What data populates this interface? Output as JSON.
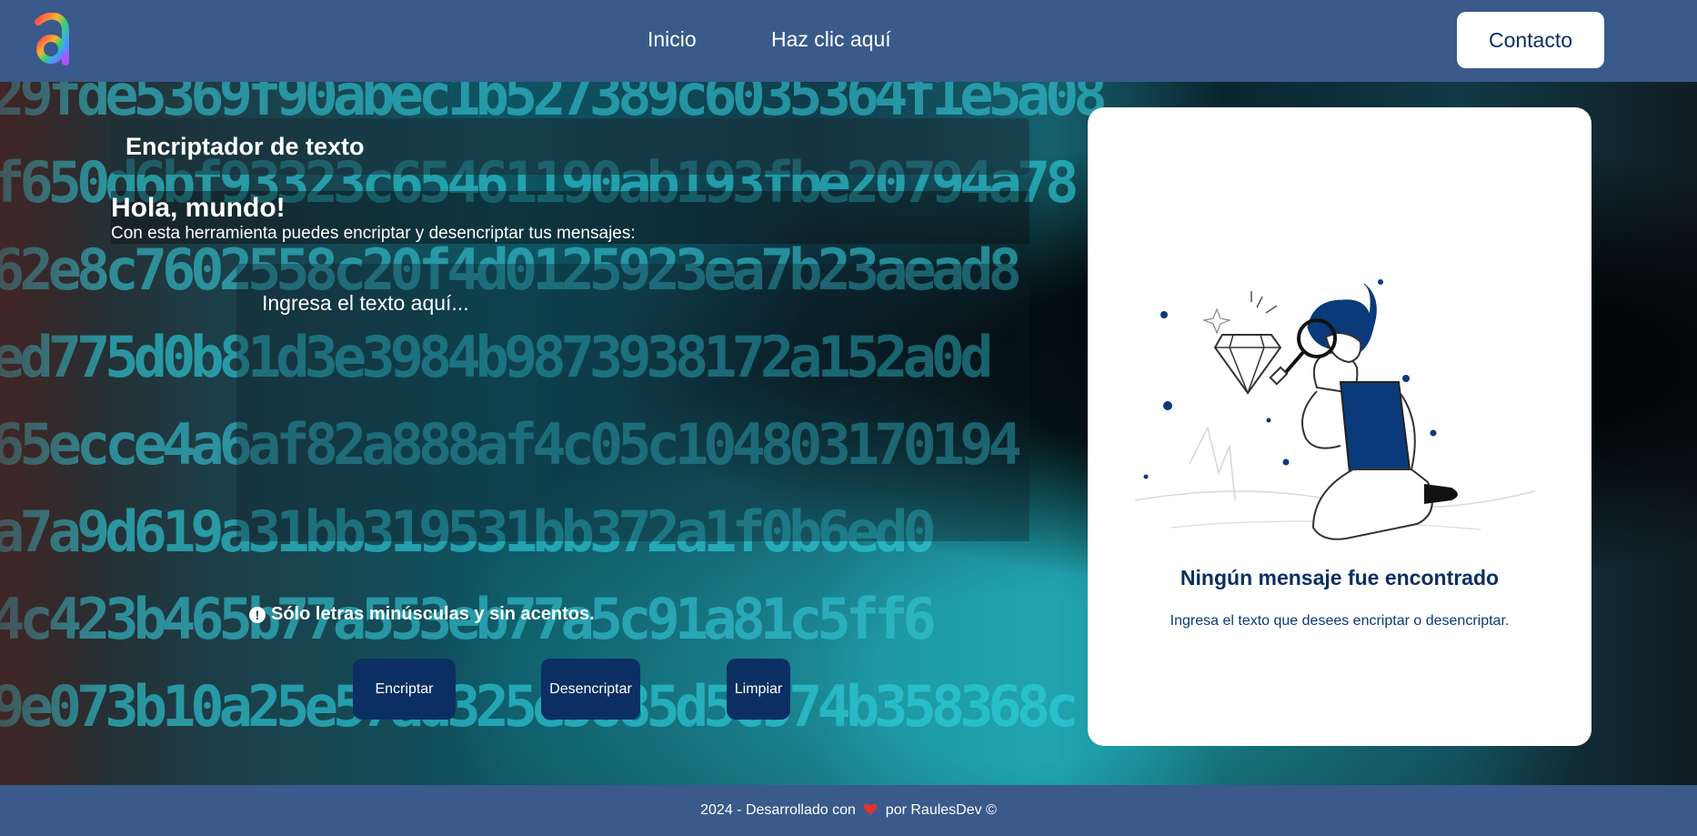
{
  "header": {
    "logo_icon": "letter-a-logo-icon",
    "nav": [
      {
        "label": "Inicio"
      },
      {
        "label": "Haz clic aquí"
      }
    ],
    "contact_label": "Contacto"
  },
  "background": {
    "code_lines": [
      "2 9 f d e 5 3 6 9 f 9 0 a b e c 1 b 5 2 7 3 8 9 c 6 0 3 5 3 6 4 f 1 e 5 a 0 8",
      "f 6 5 0 d 6 b f 9 3 3 2 3 c 6 5 4 6 1 1 9 0 a b 1 9 3 f b e 2 0 7 9 4 a 7 8",
      "6 2 e 8 c 7 6 0 2 5 5 8 c 2 0 f 4 d 0 1 2 5 9 2 3 e a 7 b 2 3 a e a d 8",
      "e d 7 7 5 d 0 b 8 1 d 3 e 3 9 8 4 b 9 8 7 3 9 3 8 1 7 2 a 1 5 2 a 0 d",
      "6 5 e c c e 4 a 6 a f 8 2 a 8 8 8 a f 4 c 0 5 c 1 0 4 8 0 3 1 7 0 1 9 4",
      "a 7 a 9 d 6 1 9 a 3 1 b b 3 1 9 5 3 1 b b 3 7 2 a 1 f 0 b 6 e d 0",
      "4 c 4 2 3 b 4 6 5 b 7 7 a 5 5 3 e b 7 7 a 5 c 9 1 a 8 1 c 5 f f 6",
      "9 e 0 7 3 b 1 0 a 2 5 e 5 7 a d 3 2 5 e 5 8 8 5 d 5 c 9 7 4 b 3 5 8 3 6 8 c"
    ]
  },
  "main": {
    "title": "Encriptador de texto",
    "greeting": "Hola, mundo!",
    "subtitle": "Con esta herramienta puedes encriptar y desencriptar tus mensajes:",
    "input_placeholder": "Ingresa el texto aquí...",
    "input_value": "",
    "warning_icon": "exclamation-circle-icon",
    "warning_text": "Sólo letras minúsculas y sin acentos.",
    "buttons": {
      "encrypt": "Encriptar",
      "decrypt": "Desencriptar",
      "clear": "Limpiar"
    }
  },
  "output_card": {
    "illustration": "person-with-magnifying-glass-and-diamond-illustration",
    "title": "Ningún mensaje fue encontrado",
    "text": "Ingresa el texto que desees encriptar o desencriptar."
  },
  "footer": {
    "text_before": "2024 - Desarrollado con",
    "heart_icon": "heart-icon",
    "text_after": "por RaulesDev",
    "copyright_symbol": "©"
  },
  "colors": {
    "header_bg": "#395a8a",
    "button_bg": "#0b2f63",
    "card_title": "#0b2f63",
    "heart": "#e0342c"
  }
}
